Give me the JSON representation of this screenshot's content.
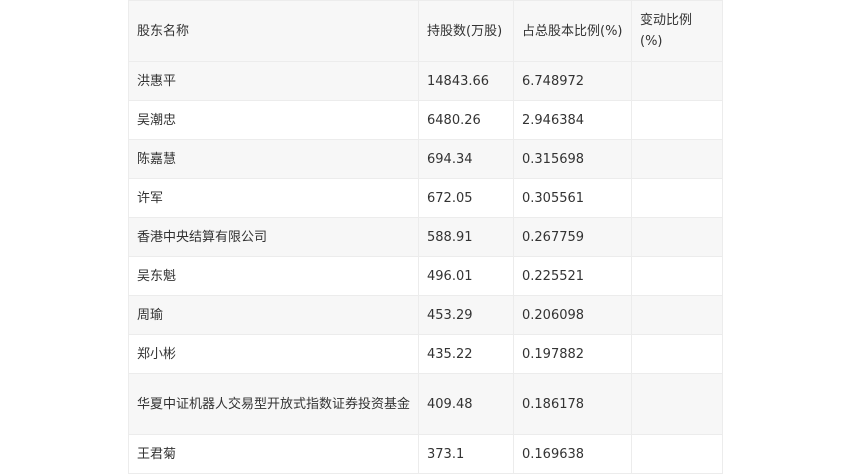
{
  "table": {
    "headers": [
      "股东名称",
      "持股数(万股)",
      "占总股本比例(%)",
      "变动比例(%)"
    ],
    "rows": [
      [
        "洪惠平",
        "14843.66",
        "6.748972",
        ""
      ],
      [
        "吴潮忠",
        "6480.26",
        "2.946384",
        ""
      ],
      [
        "陈嘉慧",
        "694.34",
        "0.315698",
        ""
      ],
      [
        "许军",
        "672.05",
        "0.305561",
        ""
      ],
      [
        "香港中央结算有限公司",
        "588.91",
        "0.267759",
        ""
      ],
      [
        "吴东魁",
        "496.01",
        "0.225521",
        ""
      ],
      [
        "周瑜",
        "453.29",
        "0.206098",
        ""
      ],
      [
        "郑小彬",
        "435.22",
        "0.197882",
        ""
      ],
      [
        "华夏中证机器人交易型开放式指数证券投资基金",
        "409.48",
        "0.186178",
        ""
      ],
      [
        "王君菊",
        "373.1",
        "0.169638",
        ""
      ]
    ]
  }
}
